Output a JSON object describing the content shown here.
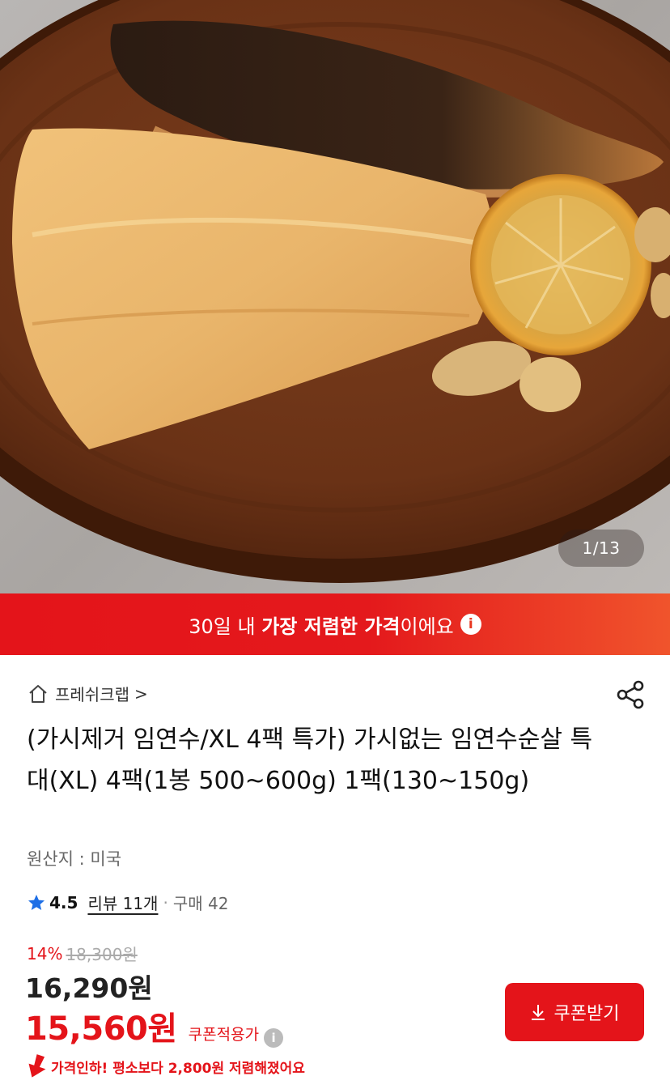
{
  "gallery": {
    "counter": "1/13",
    "image_description_icon": "grilled-fish-photo"
  },
  "banner": {
    "prefix": "30일 내 ",
    "highlight": "가장 저렴한 가격",
    "suffix": "이에요",
    "info_icon": "info-icon",
    "info_glyph": "i"
  },
  "store": {
    "name": "프레쉬크랩",
    "chevron": ">"
  },
  "product": {
    "title": "(가시제거 임연수/XL 4팩 특가) 가시없는 임연수순살 특대(XL) 4팩(1봉 500~600g) 1팩(130~150g)",
    "origin": "원산지 : 미국"
  },
  "rating": {
    "score": "4.5",
    "review": "리뷰 11개",
    "separator": "·",
    "purchases": "구매 42"
  },
  "price": {
    "discount_pct": "14%",
    "original": "18,300원",
    "sale": "16,290원",
    "coupon_price": "15,560원",
    "coupon_label": "쿠폰적용가",
    "coupon_info_glyph": "i"
  },
  "coupon_button": {
    "label": "쿠폰받기"
  },
  "price_drop": {
    "text": "가격인하! 평소보다 2,800원 저렴해졌어요"
  },
  "colors": {
    "accent": "#e4141a",
    "banner_end": "#f0542c"
  }
}
